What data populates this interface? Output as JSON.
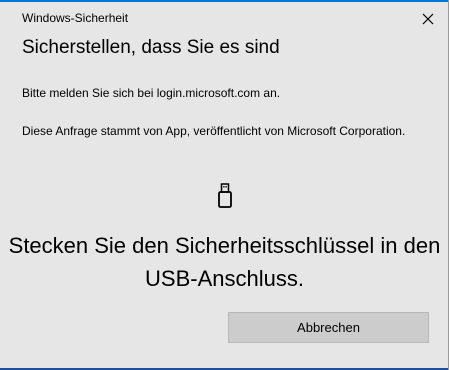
{
  "window": {
    "title": "Windows-Sicherheit"
  },
  "dialog": {
    "heading": "Sicherstellen, dass Sie es sind",
    "sign_in_text": "Bitte melden Sie sich bei login.microsoft.com an.",
    "request_text": "Diese Anfrage stammt von App, veröffentlicht von Microsoft Corporation.",
    "instruction": "Stecken Sie den Sicherheitsschlüssel in den USB-Anschluss.",
    "usb_icon": "usb-key-icon",
    "close_icon": "close-icon"
  },
  "buttons": {
    "cancel_label": "Abbrechen"
  },
  "colors": {
    "background": "#e6e6e6",
    "button": "#cccccc",
    "accent": "#0078d4"
  }
}
